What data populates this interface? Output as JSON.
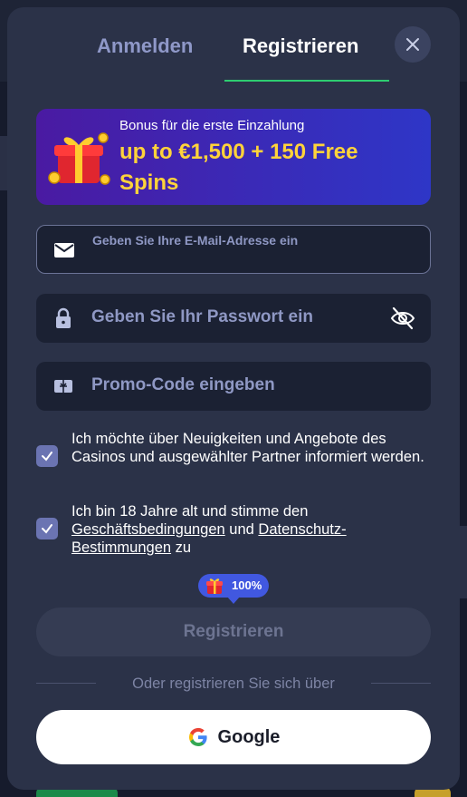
{
  "tabs": {
    "login": "Anmelden",
    "register": "Registrieren"
  },
  "bonus": {
    "subtitle": "Bonus für die erste Einzahlung",
    "title": "up to €1,500 + 150 Free Spins"
  },
  "form": {
    "email_placeholder": "Geben Sie Ihre E-Mail-Adresse ein",
    "password_placeholder": "Geben Sie Ihr Passwort ein",
    "promo_placeholder": "Promo-Code eingeben"
  },
  "consents": {
    "news": {
      "text": "Ich möchte über Neuigkeiten und Angebote des Casinos und ausgewählter Partner informiert werden.",
      "checked": true
    },
    "terms": {
      "text_before": "Ich bin 18 Jahre alt und stimme den ",
      "terms_link": "Geschäftsbedingungen",
      "text_middle": " und ",
      "privacy_link": "Datenschutz-Bestimmungen",
      "text_after": " zu",
      "checked": true
    }
  },
  "progress_badge": {
    "label": "100%",
    "icon": "gift-icon"
  },
  "submit_label": "Registrieren",
  "divider_text": "Oder registrieren Sie sich über",
  "google_label": "Google",
  "colors": {
    "accent_green": "#2ecc71",
    "bonus_yellow": "#ffd33a",
    "badge_blue": "#4158e0"
  }
}
